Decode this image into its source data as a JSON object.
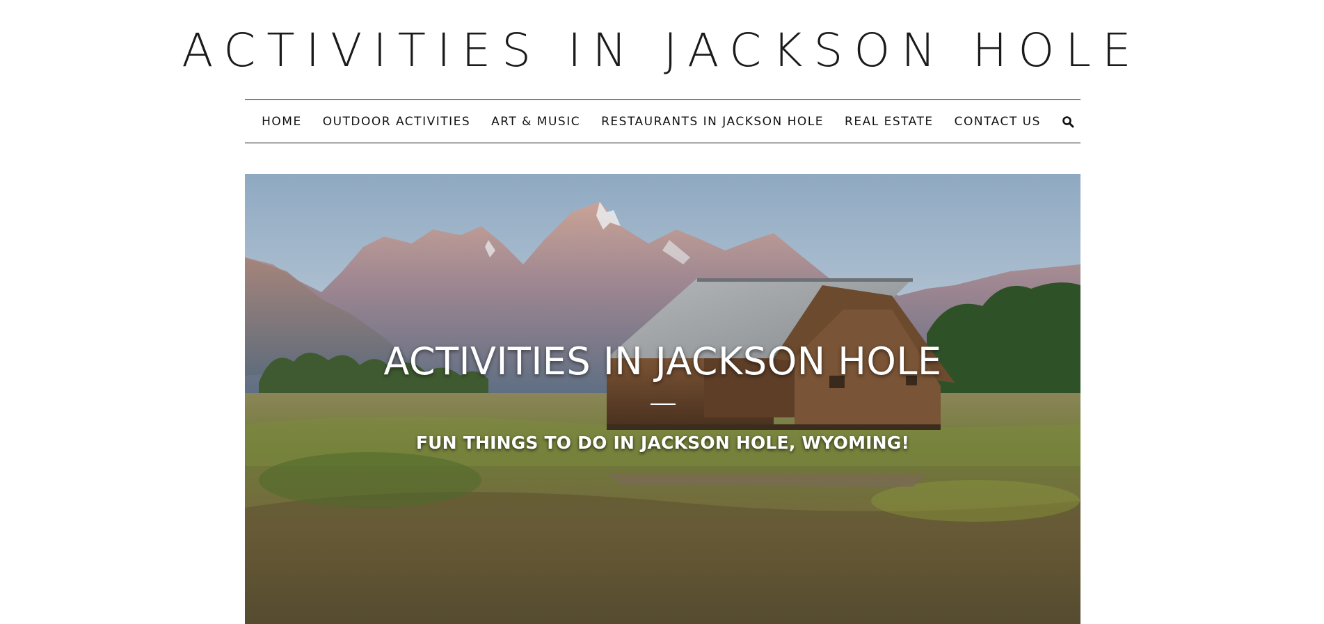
{
  "site": {
    "title": "ACTIVITIES IN JACKSON HOLE"
  },
  "nav": {
    "items": [
      {
        "label": "HOME"
      },
      {
        "label": "OUTDOOR ACTIVITIES"
      },
      {
        "label": "ART & MUSIC"
      },
      {
        "label": "RESTAURANTS IN JACKSON HOLE"
      },
      {
        "label": "REAL ESTATE"
      },
      {
        "label": "CONTACT US"
      }
    ],
    "search_icon": "search-icon"
  },
  "hero": {
    "image": "mountain-barn-photo",
    "title": "ACTIVITIES IN JACKSON HOLE",
    "subtitle": "FUN THINGS TO DO IN JACKSON HOLE, WYOMING!"
  },
  "colors": {
    "text": "#111111",
    "background": "#ffffff",
    "hero_text": "#ffffff"
  }
}
